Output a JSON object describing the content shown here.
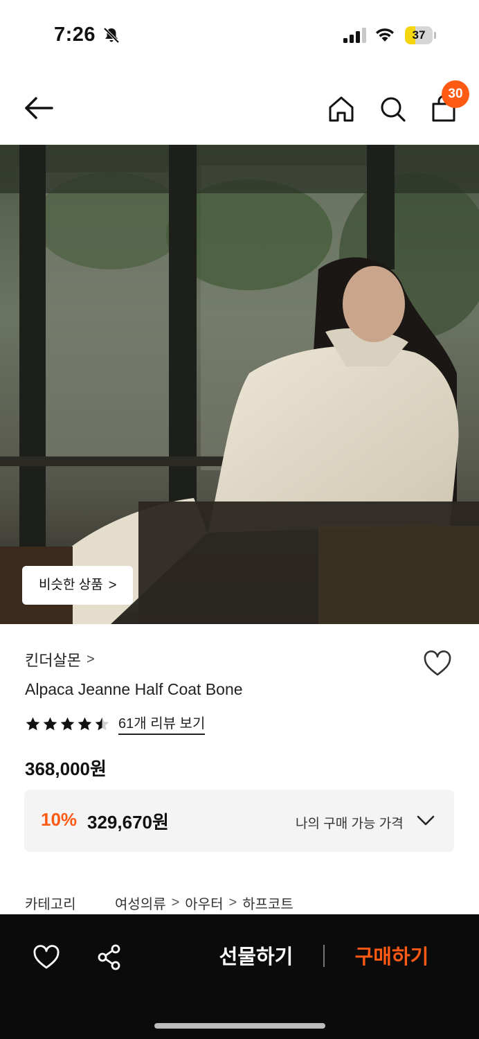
{
  "status_bar": {
    "time": "7:26",
    "battery": "37",
    "battery_level": 0.37
  },
  "nav": {
    "cart_count": "30"
  },
  "image": {
    "similar_label": "비슷한 상품",
    "similar_chevron": ">"
  },
  "product": {
    "brand": "킨더살몬",
    "brand_chevron": ">",
    "name": "Alpaca Jeanne Half Coat Bone",
    "rating": 4.5,
    "review_link": "61개 리뷰 보기",
    "price_original": "368,000원",
    "discount_rate": "10%",
    "discount_price": "329,670원",
    "my_price_label": "나의 구매 가능 가격"
  },
  "category": {
    "label": "카테고리",
    "path": [
      "여성의류",
      "아우터",
      "하프코트"
    ],
    "separator": ">"
  },
  "bottom_bar": {
    "gift": "선물하기",
    "buy": "구매하기"
  },
  "colors": {
    "accent": "#ff5a14",
    "bottom_bar_bg": "#0b0b0b",
    "battery": "#f5d50c"
  },
  "icons": [
    "bell-slash-icon",
    "signal-icon",
    "wifi-icon",
    "back-arrow-icon",
    "home-icon",
    "search-icon",
    "cart-icon",
    "heart-icon",
    "star-icon",
    "chevron-down-icon",
    "share-icon"
  ]
}
